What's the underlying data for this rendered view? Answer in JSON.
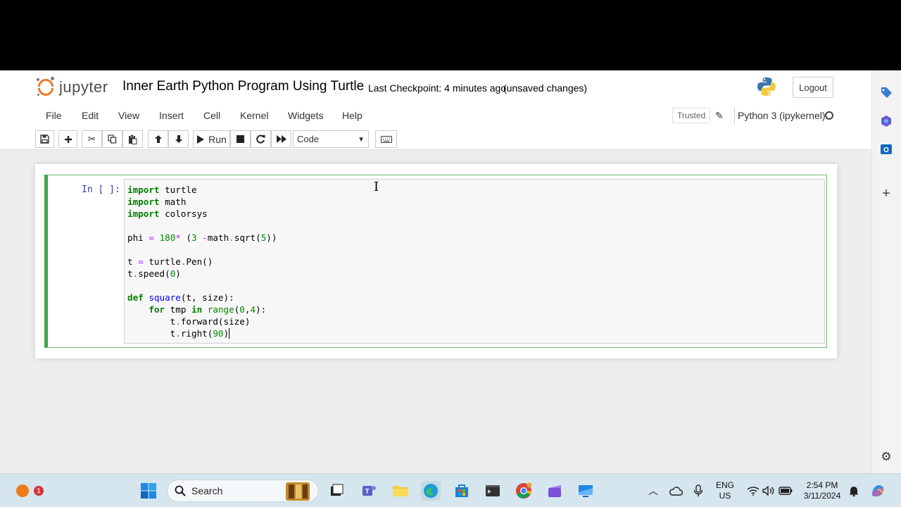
{
  "header": {
    "logo_text": "jupyter",
    "notebook_title": "Inner Earth Python Program Using Turtle",
    "checkpoint": "Last Checkpoint: 4 minutes ago",
    "unsaved": "(unsaved changes)",
    "logout_label": "Logout"
  },
  "menu": {
    "items": [
      "File",
      "Edit",
      "View",
      "Insert",
      "Cell",
      "Kernel",
      "Widgets",
      "Help"
    ],
    "trusted_label": "Trusted",
    "kernel_name": "Python 3 (ipykernel)"
  },
  "toolbar": {
    "run_label": "Run",
    "cell_type": "Code"
  },
  "cell": {
    "prompt": "In [ ]:"
  },
  "taskbar": {
    "search_label": "Search",
    "notification_count": "1",
    "lang_line1": "ENG",
    "lang_line2": "US",
    "time": "2:54 PM",
    "date": "3/11/2024"
  }
}
